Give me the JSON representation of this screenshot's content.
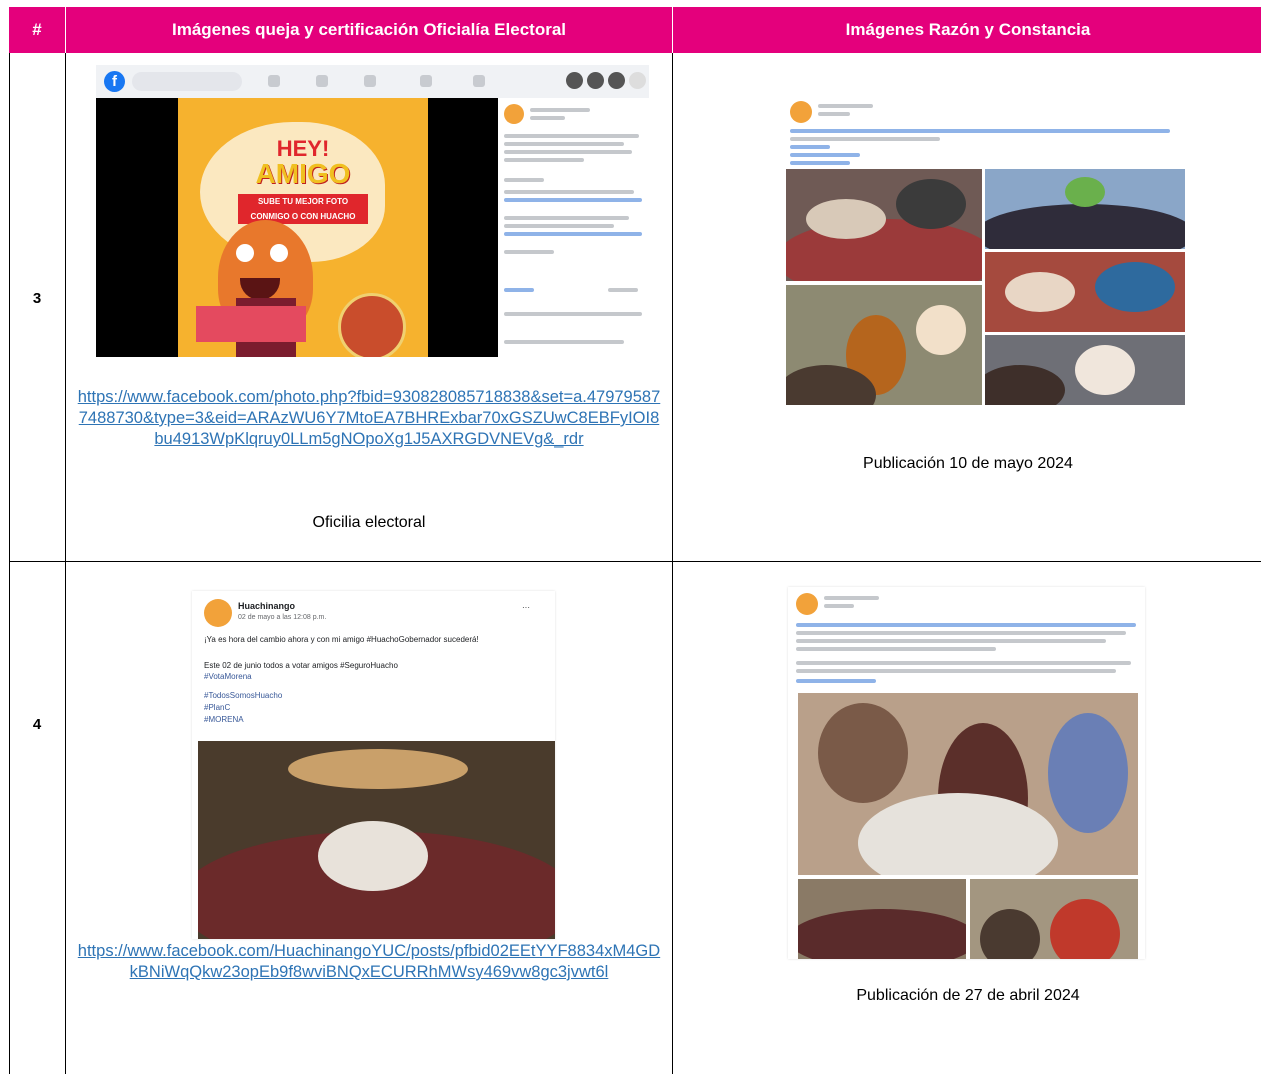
{
  "table": {
    "headers": [
      "#",
      "Imágenes queja y certificación Oficialía Electoral",
      "Imágenes Razón y Constancia"
    ],
    "rows": [
      {
        "number": "3",
        "left_link": "https://www.facebook.com/photo.php?fbid=930828085718838&set=a.479795877488730&type=3&eid=ARAzWU6Y7MtoEA7BHRExbar70xGSZUwC8EBFyIOI8bu4913WpKlqruy0LLm5gNOpoXg1J5AXRGDVNEVg&_rdr",
        "left_caption": "Oficilia electoral",
        "right_caption": "Publicación 10 de mayo 2024",
        "left_image": {
          "title_1": "HEY!",
          "title_2": "AMIGO",
          "banner": "SUBE TU MEJOR FOTO CONMIGO O CON HUACHO"
        }
      },
      {
        "number": "4",
        "left_link": "https://www.facebook.com/HuachinangoYUC/posts/pfbid02EEtYYF8834xM4GDkBNiWqQkw23opEb9f8wviBNQxECURRhMWsy469vw8gc3jvwt6l",
        "right_caption": "Publicación de 27 de abril 2024",
        "left_image": {
          "page_name": "Huachinango",
          "post_date": "02 de mayo a las 12:08 p.m.",
          "text_1": "¡Ya es hora del cambio ahora y con mi amigo #HuachoGobernador sucederá!",
          "text_2": "Este 02 de junio todos a votar amigos #SeguroHuacho",
          "hashtags": [
            "#VotaMorena",
            "#TodosSomosHuacho",
            "#PlanC",
            "#MORENA"
          ]
        }
      }
    ]
  },
  "colors": {
    "header_bg": "#e4007c",
    "header_text": "#ffffff",
    "link": "#2e74b5"
  }
}
